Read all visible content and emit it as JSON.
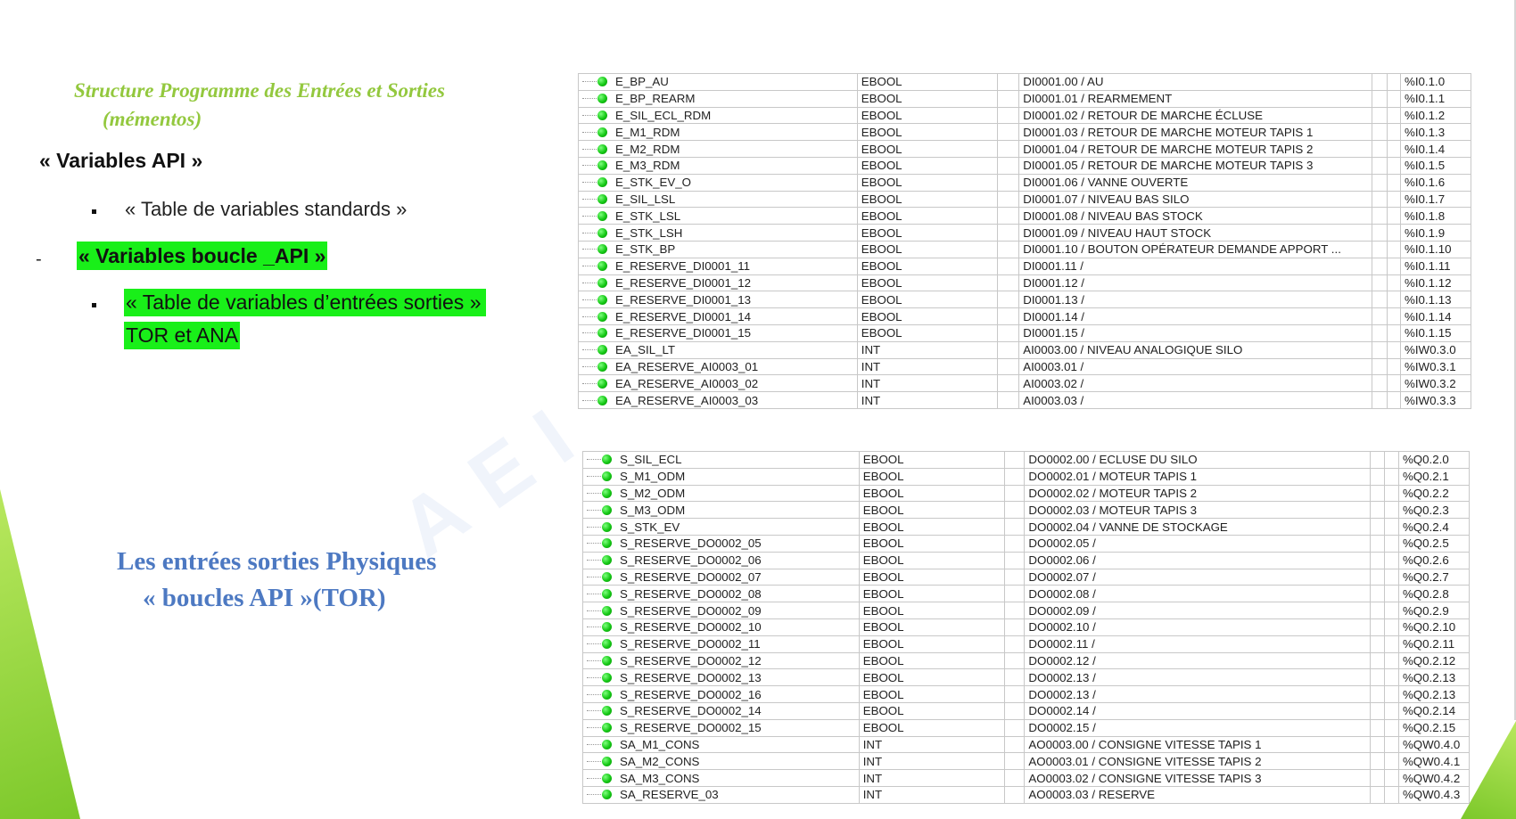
{
  "slide": {
    "title_line1": "Structure Programme des Entrées et Sorties",
    "title_line2": "(mémentos)",
    "heading_vars": "« Variables API »",
    "item_standard": "« Table de variables standards »",
    "dash": "-",
    "item_boucle": "« Variables boucle _API »",
    "item_table_es": "« Table de variables d’entrées sorties »",
    "item_tor_ana": "TOR et ANA",
    "subtitle_line1": "Les entrées sorties Physiques",
    "subtitle_line2": "« boucles API »(TOR)",
    "watermark": "AEI FORMAT",
    "colors": {
      "title_green": "#93c83e",
      "highlight_green": "#19ef19",
      "subtitle_blue": "#4d79c2",
      "status_dot_green": "#14c814"
    }
  },
  "inputs_table": {
    "rows": [
      {
        "name": "E_BP_AU",
        "type": "EBOOL",
        "comment": "DI0001.00 / AU",
        "address": "%I0.1.0"
      },
      {
        "name": "E_BP_REARM",
        "type": "EBOOL",
        "comment": "DI0001.01 / REARMEMENT",
        "address": "%I0.1.1"
      },
      {
        "name": "E_SIL_ECL_RDM",
        "type": "EBOOL",
        "comment": "DI0001.02 / RETOUR DE MARCHE ÉCLUSE",
        "address": "%I0.1.2"
      },
      {
        "name": "E_M1_RDM",
        "type": "EBOOL",
        "comment": "DI0001.03 / RETOUR DE MARCHE MOTEUR TAPIS 1",
        "address": "%I0.1.3"
      },
      {
        "name": "E_M2_RDM",
        "type": "EBOOL",
        "comment": "DI0001.04 / RETOUR DE MARCHE MOTEUR TAPIS 2",
        "address": "%I0.1.4"
      },
      {
        "name": "E_M3_RDM",
        "type": "EBOOL",
        "comment": "DI0001.05 / RETOUR DE MARCHE MOTEUR TAPIS 3",
        "address": "%I0.1.5"
      },
      {
        "name": "E_STK_EV_O",
        "type": "EBOOL",
        "comment": "DI0001.06 / VANNE OUVERTE",
        "address": "%I0.1.6"
      },
      {
        "name": "E_SIL_LSL",
        "type": "EBOOL",
        "comment": "DI0001.07 / NIVEAU BAS SILO",
        "address": "%I0.1.7"
      },
      {
        "name": "E_STK_LSL",
        "type": "EBOOL",
        "comment": "DI0001.08 / NIVEAU BAS STOCK",
        "address": "%I0.1.8"
      },
      {
        "name": "E_STK_LSH",
        "type": "EBOOL",
        "comment": "DI0001.09 / NIVEAU HAUT STOCK",
        "address": "%I0.1.9"
      },
      {
        "name": "E_STK_BP",
        "type": "EBOOL",
        "comment": "DI0001.10 / BOUTON OPÉRATEUR DEMANDE APPORT ...",
        "address": "%I0.1.10"
      },
      {
        "name": "E_RESERVE_DI0001_11",
        "type": "EBOOL",
        "comment": "DI0001.11 /",
        "address": "%I0.1.11"
      },
      {
        "name": "E_RESERVE_DI0001_12",
        "type": "EBOOL",
        "comment": "DI0001.12 /",
        "address": "%I0.1.12"
      },
      {
        "name": "E_RESERVE_DI0001_13",
        "type": "EBOOL",
        "comment": "DI0001.13 /",
        "address": "%I0.1.13"
      },
      {
        "name": "E_RESERVE_DI0001_14",
        "type": "EBOOL",
        "comment": "DI0001.14 /",
        "address": "%I0.1.14"
      },
      {
        "name": "E_RESERVE_DI0001_15",
        "type": "EBOOL",
        "comment": "DI0001.15 /",
        "address": "%I0.1.15"
      },
      {
        "name": "EA_SIL_LT",
        "type": "INT",
        "comment": "AI0003.00 / NIVEAU ANALOGIQUE SILO",
        "address": "%IW0.3.0"
      },
      {
        "name": "EA_RESERVE_AI0003_01",
        "type": "INT",
        "comment": "AI0003.01 /",
        "address": "%IW0.3.1"
      },
      {
        "name": "EA_RESERVE_AI0003_02",
        "type": "INT",
        "comment": "AI0003.02 /",
        "address": "%IW0.3.2"
      },
      {
        "name": "EA_RESERVE_AI0003_03",
        "type": "INT",
        "comment": "AI0003.03 /",
        "address": "%IW0.3.3"
      }
    ]
  },
  "outputs_table": {
    "rows": [
      {
        "name": "S_SIL_ECL",
        "type": "EBOOL",
        "comment": "DO0002.00 / ECLUSE DU SILO",
        "address": "%Q0.2.0"
      },
      {
        "name": "S_M1_ODM",
        "type": "EBOOL",
        "comment": "DO0002.01 / MOTEUR TAPIS 1",
        "address": "%Q0.2.1"
      },
      {
        "name": "S_M2_ODM",
        "type": "EBOOL",
        "comment": "DO0002.02 / MOTEUR TAPIS 2",
        "address": "%Q0.2.2"
      },
      {
        "name": "S_M3_ODM",
        "type": "EBOOL",
        "comment": "DO0002.03 / MOTEUR TAPIS 3",
        "address": "%Q0.2.3"
      },
      {
        "name": "S_STK_EV",
        "type": "EBOOL",
        "comment": "DO0002.04 / VANNE DE STOCKAGE",
        "address": "%Q0.2.4"
      },
      {
        "name": "S_RESERVE_DO0002_05",
        "type": "EBOOL",
        "comment": "DO0002.05 /",
        "address": "%Q0.2.5"
      },
      {
        "name": "S_RESERVE_DO0002_06",
        "type": "EBOOL",
        "comment": "DO0002.06 /",
        "address": "%Q0.2.6"
      },
      {
        "name": "S_RESERVE_DO0002_07",
        "type": "EBOOL",
        "comment": "DO0002.07 /",
        "address": "%Q0.2.7"
      },
      {
        "name": "S_RESERVE_DO0002_08",
        "type": "EBOOL",
        "comment": "DO0002.08 /",
        "address": "%Q0.2.8"
      },
      {
        "name": "S_RESERVE_DO0002_09",
        "type": "EBOOL",
        "comment": "DO0002.09 /",
        "address": "%Q0.2.9"
      },
      {
        "name": "S_RESERVE_DO0002_10",
        "type": "EBOOL",
        "comment": "DO0002.10 /",
        "address": "%Q0.2.10"
      },
      {
        "name": "S_RESERVE_DO0002_11",
        "type": "EBOOL",
        "comment": "DO0002.11 /",
        "address": "%Q0.2.11"
      },
      {
        "name": "S_RESERVE_DO0002_12",
        "type": "EBOOL",
        "comment": "DO0002.12 /",
        "address": "%Q0.2.12"
      },
      {
        "name": "S_RESERVE_DO0002_13",
        "type": "EBOOL",
        "comment": "DO0002.13 /",
        "address": "%Q0.2.13"
      },
      {
        "name": "S_RESERVE_DO0002_16",
        "type": "EBOOL",
        "comment": "DO0002.13 /",
        "address": "%Q0.2.13"
      },
      {
        "name": "S_RESERVE_DO0002_14",
        "type": "EBOOL",
        "comment": "DO0002.14 /",
        "address": "%Q0.2.14"
      },
      {
        "name": "S_RESERVE_DO0002_15",
        "type": "EBOOL",
        "comment": "DO0002.15 /",
        "address": "%Q0.2.15"
      },
      {
        "name": "SA_M1_CONS",
        "type": "INT",
        "comment": "AO0003.00 / CONSIGNE VITESSE TAPIS 1",
        "address": "%QW0.4.0"
      },
      {
        "name": "SA_M2_CONS",
        "type": "INT",
        "comment": "AO0003.01 / CONSIGNE VITESSE TAPIS 2",
        "address": "%QW0.4.1"
      },
      {
        "name": "SA_M3_CONS",
        "type": "INT",
        "comment": "AO0003.02 / CONSIGNE VITESSE TAPIS 3",
        "address": "%QW0.4.2"
      },
      {
        "name": "SA_RESERVE_03",
        "type": "INT",
        "comment": "AO0003.03 / RESERVE",
        "address": "%QW0.4.3"
      }
    ]
  }
}
